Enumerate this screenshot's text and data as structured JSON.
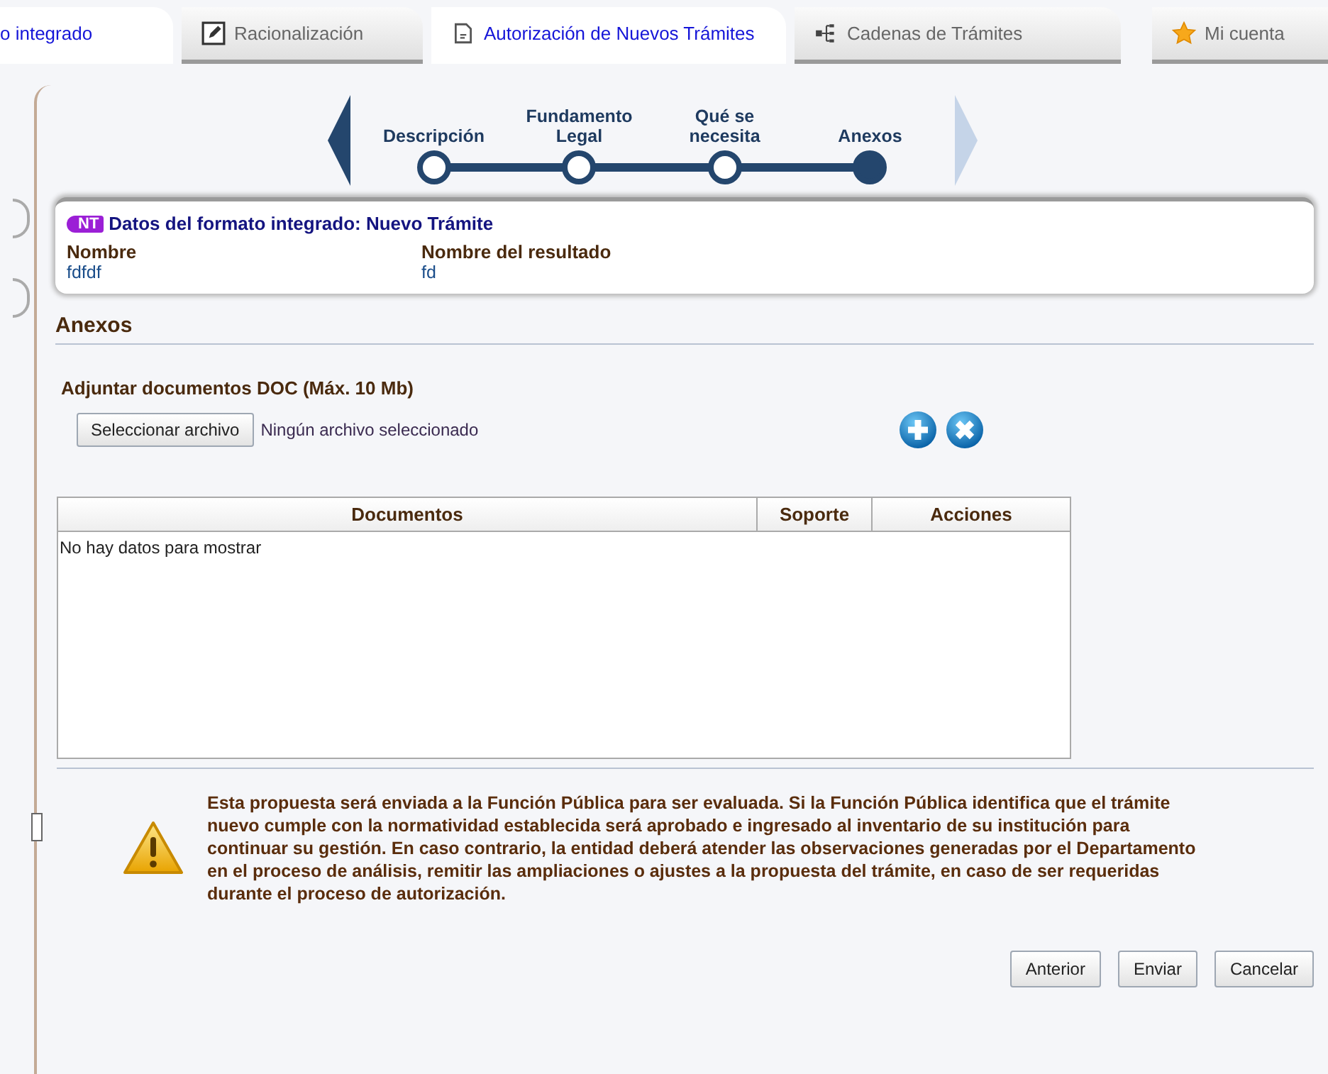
{
  "tabs": [
    {
      "label": "o integrado",
      "kind": "plain",
      "selected": true
    },
    {
      "label": "Racionalización",
      "kind": "edit",
      "selected": false
    },
    {
      "label": "Autorización de Nuevos Trámites",
      "kind": "doc",
      "selected": true
    },
    {
      "label": "Cadenas de Trámites",
      "kind": "tree",
      "selected": false
    }
  ],
  "account_tab": {
    "label": "Mi cuenta"
  },
  "steps": [
    {
      "label": "Descripción",
      "current": false
    },
    {
      "label": "Fundamento Legal",
      "current": false
    },
    {
      "label": "Qué se necesita",
      "current": false
    },
    {
      "label": "Anexos",
      "current": true
    }
  ],
  "summary": {
    "badge": "NT",
    "title": "Datos del formato integrado: Nuevo Trámite",
    "fields": [
      {
        "label": "Nombre",
        "value": "fdfdf"
      },
      {
        "label": "Nombre del resultado",
        "value": "fd"
      }
    ]
  },
  "section_title": "Anexos",
  "upload": {
    "label": "Adjuntar documentos DOC (Máx. 10 Mb)",
    "button": "Seleccionar archivo",
    "status": "Ningún archivo seleccionado"
  },
  "table": {
    "columns": [
      "Documentos",
      "Soporte",
      "Acciones"
    ],
    "empty_message": "No hay datos para mostrar"
  },
  "warning": "Esta propuesta será enviada a la Función Pública para ser evaluada. Si la Función Pública identifica que el trámite nuevo cumple con la normatividad establecida será aprobado e ingresado al inventario de su institución para continuar su gestión. En caso contrario, la entidad deberá atender las observaciones generadas por el Departamento en el proceso de análisis, remitir las ampliaciones o ajustes a la propuesta del trámite, en caso de ser requeridas durante el proceso de autorización.",
  "buttons": [
    "Anterior",
    "Enviar",
    "Cancelar"
  ]
}
